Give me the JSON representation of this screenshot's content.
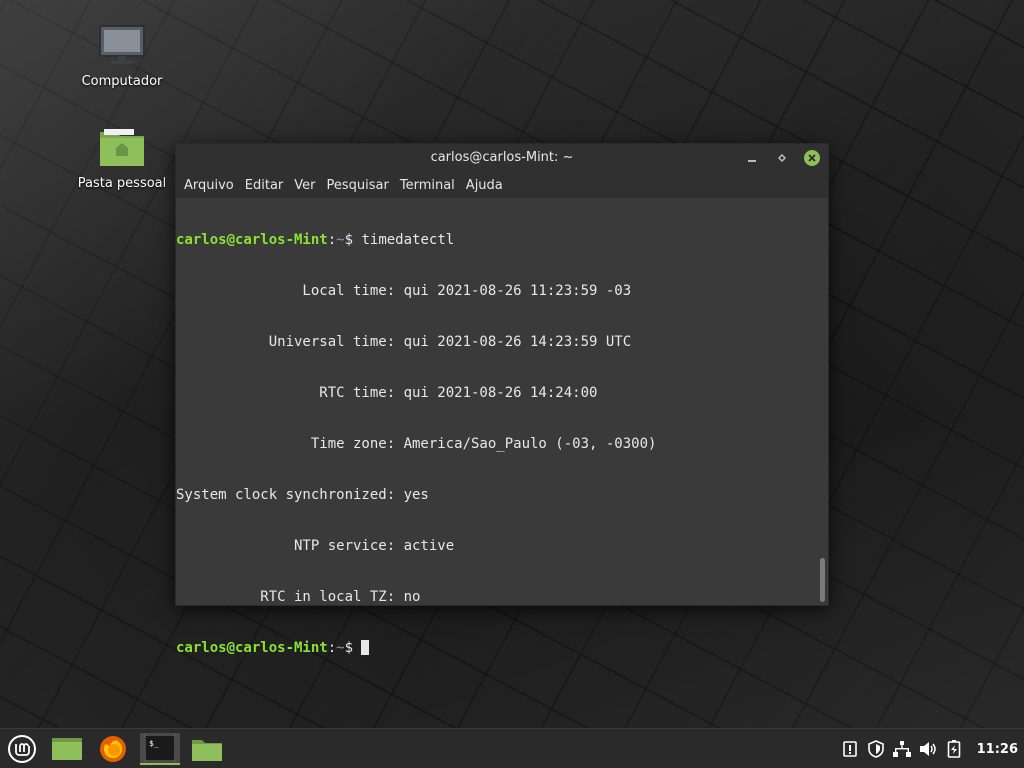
{
  "desktop": {
    "icons": [
      {
        "label": "Computador",
        "icon": "computer-icon"
      },
      {
        "label": "Pasta pessoal",
        "icon": "home-folder-icon"
      }
    ]
  },
  "window": {
    "title": "carlos@carlos-Mint: ~",
    "menu": [
      "Arquivo",
      "Editar",
      "Ver",
      "Pesquisar",
      "Terminal",
      "Ajuda"
    ]
  },
  "terminal": {
    "prompt_user": "carlos@carlos-Mint",
    "prompt_path": "~",
    "prompt_symbol": "$",
    "command": "timedatectl",
    "output": [
      "               Local time: qui 2021-08-26 11:23:59 -03",
      "           Universal time: qui 2021-08-26 14:23:59 UTC",
      "                 RTC time: qui 2021-08-26 14:24:00",
      "                Time zone: America/Sao_Paulo (-03, -0300)",
      "System clock synchronized: yes",
      "              NTP service: active",
      "          RTC in local TZ: no"
    ]
  },
  "taskbar": {
    "buttons": [
      {
        "name": "menu-button",
        "icon": "mint-logo-icon"
      },
      {
        "name": "show-desktop-button",
        "icon": "desktop-icon"
      },
      {
        "name": "firefox-button",
        "icon": "firefox-icon"
      },
      {
        "name": "terminal-button",
        "icon": "terminal-icon",
        "active": true
      },
      {
        "name": "files-button",
        "icon": "folder-icon"
      }
    ],
    "tray": [
      "update-icon",
      "shield-icon",
      "network-icon",
      "volume-icon",
      "battery-icon"
    ],
    "clock": "11:26"
  },
  "colors": {
    "accent": "#8fbf5a",
    "prompt_user": "#8ae234",
    "prompt_path": "#729fcf",
    "terminal_bg": "#3a3a3a"
  }
}
